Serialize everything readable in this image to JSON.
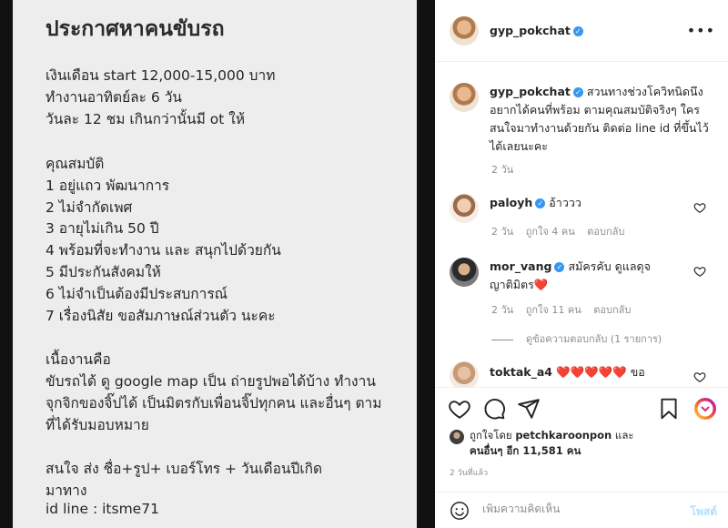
{
  "image": {
    "title": "ประกาศหาคนขับรถ",
    "lines": [
      "เงินเดือน start 12,000-15,000 บาท",
      "ทำงานอาทิตย์ละ 6 วัน",
      "วันละ 12 ชม เกินกว่านั้นมี ot ให้",
      "คุณสมบัติ",
      "1 อยู่แถว พัฒนาการ",
      "2 ไม่จำกัดเพศ",
      "3 อายุไม่เกิน 50 ปี",
      "4 พร้อมที่จะทำงาน และ สนุกไปด้วยกัน",
      "5 มีประกันสังคมให้",
      "6 ไม่จำเป็นต้องมีประสบการณ์",
      "7 เรื่องนิสัย ขอสัมภาษณ์ส่วนตัว นะคะ",
      "เนื้องานคือ",
      "ขับรถได้ ดู google map เป็น ถ่ายรูปพอได้บ้าง ทำงาน",
      "จุกจิกของจิ๊ปได้ เป็นมิตรกับเพื่อนจิ๊ปทุกคน และอื่นๆ ตาม",
      "ที่ได้รับมอบหมาย",
      "สนใจ ส่ง ชื่อ+รูป+ เบอร์โทร + วันเดือนปีเกิด",
      "มาทาง",
      "id line : itsme71"
    ]
  },
  "header": {
    "username": "gyp_pokchat",
    "more_icon": "more-horizontal-icon"
  },
  "caption": {
    "username": "gyp_pokchat",
    "text": "สวนทางช่วงโควิทนิดนึง อยากได้คนที่พร้อม ตามคุณสมบัติจริงๆ ใครสนใจมาทำงานด้วยกัน ติดต่อ line id ที่ขึ้นไว้ได้เลยนะคะ",
    "age": "2 วัน"
  },
  "comments": [
    {
      "username": "paloyh",
      "text": "อ้าววว",
      "age": "2 วัน",
      "likes": "ถูกใจ 4 คน",
      "reply": "ตอบกลับ"
    },
    {
      "username": "mor_vang",
      "text": "สมัครคับ ดูแลดุจญาติมิตร❤️",
      "age": "2 วัน",
      "likes": "ถูกใจ 11 คน",
      "reply": "ตอบกลับ",
      "view_replies": "ดูข้อความตอบกลับ (1 รายการ)"
    },
    {
      "username": "toktak_a4",
      "text": "❤️❤️❤️❤️❤️ ขอ"
    }
  ],
  "likes": {
    "prefix": "ถูกใจโดย",
    "liker": "petchkaroonpon",
    "and": "และ",
    "others": "คนอื่นๆ อีก 11,581 คน"
  },
  "post_age": "2 วันที่แล้ว",
  "add_comment": {
    "placeholder": "เพิ่มความคิดเห็น",
    "post_label": "โพสต์"
  },
  "colors": {
    "verified": "#3897f0",
    "igtv_gradient": [
      "#feda75",
      "#fa7e1e",
      "#d62976",
      "#962fbf"
    ],
    "heart": "#ed4956"
  }
}
